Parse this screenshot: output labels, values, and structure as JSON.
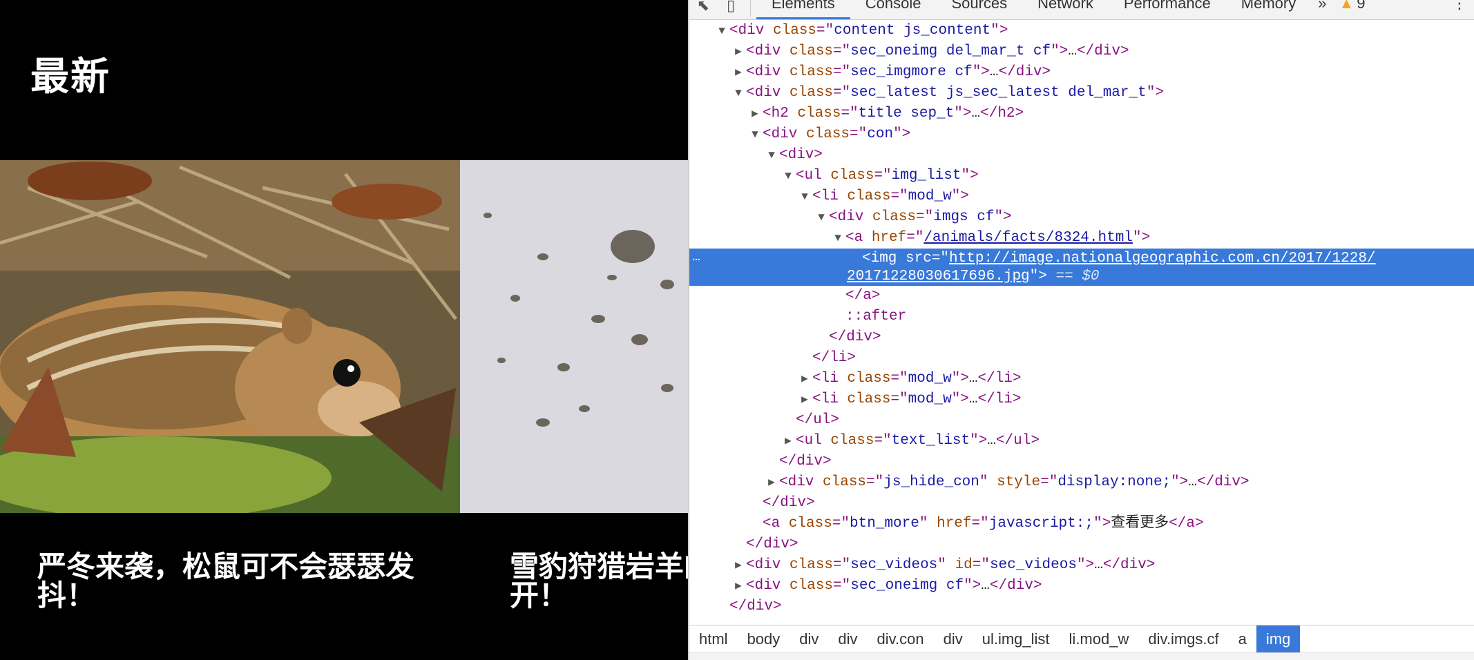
{
  "page": {
    "section_title": "最新",
    "cards": [
      {
        "title": "严冬来袭，松鼠可不会瑟瑟发\n抖！"
      },
      {
        "title": "雪豹狩猎岩羊的\n开！"
      }
    ]
  },
  "devtools": {
    "tabs": [
      "Elements",
      "Console",
      "Sources",
      "Network",
      "Performance",
      "Memory"
    ],
    "active_tab": "Elements",
    "more_tabs": "»",
    "warning_count": "9",
    "kebab": "⋮",
    "dom_lines": [
      {
        "indent": 2,
        "tw": "▼",
        "parts": [
          [
            "tag",
            "<div "
          ],
          [
            "attr",
            "class"
          ],
          [
            "tag",
            "=\""
          ],
          [
            "val",
            "content js_content"
          ],
          [
            "tag",
            "\">"
          ]
        ]
      },
      {
        "indent": 3,
        "tw": "▶",
        "parts": [
          [
            "tag",
            "<div "
          ],
          [
            "attr",
            "class"
          ],
          [
            "tag",
            "=\""
          ],
          [
            "val",
            "sec_oneimg del_mar_t cf"
          ],
          [
            "tag",
            "\">"
          ],
          [
            "text",
            "…"
          ],
          [
            "tag",
            "</div>"
          ]
        ]
      },
      {
        "indent": 3,
        "tw": "▶",
        "parts": [
          [
            "tag",
            "<div "
          ],
          [
            "attr",
            "class"
          ],
          [
            "tag",
            "=\""
          ],
          [
            "val",
            "sec_imgmore cf"
          ],
          [
            "tag",
            "\">"
          ],
          [
            "text",
            "…"
          ],
          [
            "tag",
            "</div>"
          ]
        ]
      },
      {
        "indent": 3,
        "tw": "▼",
        "parts": [
          [
            "tag",
            "<div "
          ],
          [
            "attr",
            "class"
          ],
          [
            "tag",
            "=\""
          ],
          [
            "val",
            "sec_latest js_sec_latest del_mar_t"
          ],
          [
            "tag",
            "\">"
          ]
        ]
      },
      {
        "indent": 4,
        "tw": "▶",
        "parts": [
          [
            "tag",
            "<h2 "
          ],
          [
            "attr",
            "class"
          ],
          [
            "tag",
            "=\""
          ],
          [
            "val",
            "title sep_t"
          ],
          [
            "tag",
            "\">"
          ],
          [
            "text",
            "…"
          ],
          [
            "tag",
            "</h2>"
          ]
        ]
      },
      {
        "indent": 4,
        "tw": "▼",
        "parts": [
          [
            "tag",
            "<div "
          ],
          [
            "attr",
            "class"
          ],
          [
            "tag",
            "=\""
          ],
          [
            "val",
            "con"
          ],
          [
            "tag",
            "\">"
          ]
        ]
      },
      {
        "indent": 5,
        "tw": "▼",
        "parts": [
          [
            "tag",
            "<div>"
          ]
        ]
      },
      {
        "indent": 6,
        "tw": "▼",
        "parts": [
          [
            "tag",
            "<ul "
          ],
          [
            "attr",
            "class"
          ],
          [
            "tag",
            "=\""
          ],
          [
            "val",
            "img_list"
          ],
          [
            "tag",
            "\">"
          ]
        ]
      },
      {
        "indent": 7,
        "tw": "▼",
        "parts": [
          [
            "tag",
            "<li "
          ],
          [
            "attr",
            "class"
          ],
          [
            "tag",
            "=\""
          ],
          [
            "val",
            "mod_w"
          ],
          [
            "tag",
            "\">"
          ]
        ]
      },
      {
        "indent": 8,
        "tw": "▼",
        "parts": [
          [
            "tag",
            "<div "
          ],
          [
            "attr",
            "class"
          ],
          [
            "tag",
            "=\""
          ],
          [
            "val",
            "imgs cf"
          ],
          [
            "tag",
            "\">"
          ]
        ]
      },
      {
        "indent": 9,
        "tw": "▼",
        "parts": [
          [
            "tag",
            "<a "
          ],
          [
            "attr",
            "href"
          ],
          [
            "tag",
            "=\""
          ],
          [
            "link",
            "/animals/facts/8324.html"
          ],
          [
            "tag",
            "\">"
          ]
        ]
      },
      {
        "indent": 10,
        "tw": "",
        "selected": true,
        "tall": true,
        "parts": [
          [
            "tag",
            "<img "
          ],
          [
            "attr",
            "src"
          ],
          [
            "tag",
            "=\""
          ],
          [
            "link",
            "http://image.nationalgeographic.com.cn/2017/1228/\n20171228030617696.jpg"
          ],
          [
            "tag",
            "\">"
          ],
          [
            "eq0",
            " == $0"
          ]
        ]
      },
      {
        "indent": 9,
        "tw": "",
        "parts": [
          [
            "tag",
            "</a>"
          ]
        ]
      },
      {
        "indent": 9,
        "tw": "",
        "parts": [
          [
            "pseudo",
            "::after"
          ]
        ]
      },
      {
        "indent": 8,
        "tw": "",
        "parts": [
          [
            "tag",
            "</div>"
          ]
        ]
      },
      {
        "indent": 7,
        "tw": "",
        "parts": [
          [
            "tag",
            "</li>"
          ]
        ]
      },
      {
        "indent": 7,
        "tw": "▶",
        "parts": [
          [
            "tag",
            "<li "
          ],
          [
            "attr",
            "class"
          ],
          [
            "tag",
            "=\""
          ],
          [
            "val",
            "mod_w"
          ],
          [
            "tag",
            "\">"
          ],
          [
            "text",
            "…"
          ],
          [
            "tag",
            "</li>"
          ]
        ]
      },
      {
        "indent": 7,
        "tw": "▶",
        "parts": [
          [
            "tag",
            "<li "
          ],
          [
            "attr",
            "class"
          ],
          [
            "tag",
            "=\""
          ],
          [
            "val",
            "mod_w"
          ],
          [
            "tag",
            "\">"
          ],
          [
            "text",
            "…"
          ],
          [
            "tag",
            "</li>"
          ]
        ]
      },
      {
        "indent": 6,
        "tw": "",
        "parts": [
          [
            "tag",
            "</ul>"
          ]
        ]
      },
      {
        "indent": 6,
        "tw": "▶",
        "parts": [
          [
            "tag",
            "<ul "
          ],
          [
            "attr",
            "class"
          ],
          [
            "tag",
            "=\""
          ],
          [
            "val",
            "text_list"
          ],
          [
            "tag",
            "\">"
          ],
          [
            "text",
            "…"
          ],
          [
            "tag",
            "</ul>"
          ]
        ]
      },
      {
        "indent": 5,
        "tw": "",
        "parts": [
          [
            "tag",
            "</div>"
          ]
        ]
      },
      {
        "indent": 5,
        "tw": "▶",
        "parts": [
          [
            "tag",
            "<div "
          ],
          [
            "attr",
            "class"
          ],
          [
            "tag",
            "=\""
          ],
          [
            "val",
            "js_hide_con"
          ],
          [
            "tag",
            "\" "
          ],
          [
            "attr",
            "style"
          ],
          [
            "tag",
            "=\""
          ],
          [
            "val",
            "display:none;"
          ],
          [
            "tag",
            "\">"
          ],
          [
            "text",
            "…"
          ],
          [
            "tag",
            "</div>"
          ]
        ]
      },
      {
        "indent": 4,
        "tw": "",
        "parts": [
          [
            "tag",
            "</div>"
          ]
        ]
      },
      {
        "indent": 4,
        "tw": "",
        "parts": [
          [
            "tag",
            "<a "
          ],
          [
            "attr",
            "class"
          ],
          [
            "tag",
            "=\""
          ],
          [
            "val",
            "btn_more"
          ],
          [
            "tag",
            "\" "
          ],
          [
            "attr",
            "href"
          ],
          [
            "tag",
            "=\""
          ],
          [
            "val",
            "javascript:;"
          ],
          [
            "tag",
            "\">"
          ],
          [
            "text",
            "查看更多"
          ],
          [
            "tag",
            "</a>"
          ]
        ]
      },
      {
        "indent": 3,
        "tw": "",
        "parts": [
          [
            "tag",
            "</div>"
          ]
        ]
      },
      {
        "indent": 3,
        "tw": "▶",
        "parts": [
          [
            "tag",
            "<div "
          ],
          [
            "attr",
            "class"
          ],
          [
            "tag",
            "=\""
          ],
          [
            "val",
            "sec_videos"
          ],
          [
            "tag",
            "\" "
          ],
          [
            "attr",
            "id"
          ],
          [
            "tag",
            "=\""
          ],
          [
            "val",
            "sec_videos"
          ],
          [
            "tag",
            "\">"
          ],
          [
            "text",
            "…"
          ],
          [
            "tag",
            "</div>"
          ]
        ]
      },
      {
        "indent": 3,
        "tw": "▶",
        "parts": [
          [
            "tag",
            "<div "
          ],
          [
            "attr",
            "class"
          ],
          [
            "tag",
            "=\""
          ],
          [
            "val",
            "sec_oneimg cf"
          ],
          [
            "tag",
            "\">"
          ],
          [
            "text",
            "…"
          ],
          [
            "tag",
            "</div>"
          ]
        ]
      },
      {
        "indent": 2,
        "tw": "",
        "parts": [
          [
            "tag",
            "</div>"
          ]
        ]
      }
    ],
    "breadcrumbs": [
      "html",
      "body",
      "div",
      "div",
      "div.con",
      "div",
      "ul.img_list",
      "li.mod_w",
      "div.imgs.cf",
      "a",
      "img"
    ],
    "active_breadcrumb": "img"
  }
}
